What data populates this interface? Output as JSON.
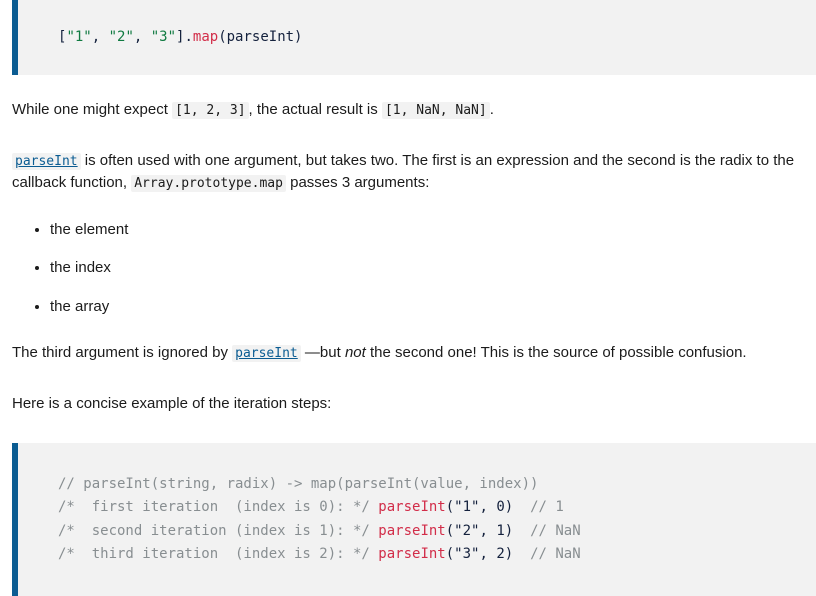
{
  "top_code_block": {
    "name": "map-parseint-example",
    "lines": [
      [
        {
          "t": "[",
          "c": "plain"
        },
        {
          "t": "\"1\"",
          "c": "str"
        },
        {
          "t": ", ",
          "c": "plain"
        },
        {
          "t": "\"2\"",
          "c": "str"
        },
        {
          "t": ", ",
          "c": "plain"
        },
        {
          "t": "\"3\"",
          "c": "str"
        },
        {
          "t": "].",
          "c": "plain"
        },
        {
          "t": "map",
          "c": "fn"
        },
        {
          "t": "(parseInt)",
          "c": "plain"
        }
      ]
    ],
    "plain_text": "[\"1\", \"2\", \"3\"].map(parseInt)"
  },
  "paragraph_1": {
    "before": "While one might expect ",
    "code_expected": "[1, 2, 3]",
    "middle": ", the actual result is ",
    "code_actual": "[1, NaN, NaN]",
    "after": "."
  },
  "paragraph_2": {
    "link_parseint": "parseInt",
    "text_1": " is often used with one argument, but takes two. The first is an expression and the second is the radix to the callback function, ",
    "code_map": "Array.prototype.map",
    "text_2": " passes 3 arguments:"
  },
  "bullet_list": {
    "items": [
      "the element",
      "the index",
      "the array"
    ]
  },
  "paragraph_3": {
    "text_1": "The third argument is ignored by ",
    "link_parseint": "parseInt",
    "text_2": " —but ",
    "emphasis": "not",
    "text_3": " the second one! This is the source of possible confusion."
  },
  "paragraph_4": {
    "text": "Here is a concise example of the iteration steps:"
  },
  "bottom_code_block": {
    "name": "iteration-steps-example",
    "lines": [
      [
        {
          "t": "// parseInt(string, radix) -> map(parseInt(value, index))",
          "c": "comment"
        }
      ],
      [
        {
          "t": "/*  first iteration  (index is 0): */ ",
          "c": "comment"
        },
        {
          "t": "parseInt",
          "c": "fn"
        },
        {
          "t": "(",
          "c": "plain"
        },
        {
          "t": "\"1\"",
          "c": "plain"
        },
        {
          "t": ", ",
          "c": "plain"
        },
        {
          "t": "0",
          "c": "num"
        },
        {
          "t": ")",
          "c": "plain"
        },
        {
          "t": "  ",
          "c": "plain"
        },
        {
          "t": "// 1",
          "c": "comment"
        }
      ],
      [
        {
          "t": "/*  second iteration (index is 1): */ ",
          "c": "comment"
        },
        {
          "t": "parseInt",
          "c": "fn"
        },
        {
          "t": "(",
          "c": "plain"
        },
        {
          "t": "\"2\"",
          "c": "plain"
        },
        {
          "t": ", ",
          "c": "plain"
        },
        {
          "t": "1",
          "c": "num"
        },
        {
          "t": ")",
          "c": "plain"
        },
        {
          "t": "  ",
          "c": "plain"
        },
        {
          "t": "// NaN",
          "c": "comment"
        }
      ],
      [
        {
          "t": "/*  third iteration  (index is 2): */ ",
          "c": "comment"
        },
        {
          "t": "parseInt",
          "c": "fn"
        },
        {
          "t": "(",
          "c": "plain"
        },
        {
          "t": "\"3\"",
          "c": "plain"
        },
        {
          "t": ", ",
          "c": "plain"
        },
        {
          "t": "2",
          "c": "num"
        },
        {
          "t": ")",
          "c": "plain"
        },
        {
          "t": "  ",
          "c": "plain"
        },
        {
          "t": "// NaN",
          "c": "comment"
        }
      ]
    ],
    "plain_text": "// parseInt(string, radix) -> map(parseInt(value, index))\n/*  first iteration  (index is 0): */ parseInt(\"1\", 0)  // 1\n/*  second iteration (index is 1): */ parseInt(\"2\", 1)  // NaN\n/*  third iteration  (index is 2): */ parseInt(\"3\", 2)  // NaN"
  },
  "colors": {
    "page_background": "#ffffff",
    "code_background": "#f2f2f2",
    "code_accent_border": "#0b5c92",
    "link": "#0b5c92",
    "token_string": "#107a41",
    "token_function": "#d22d49",
    "token_comment": "#888e91",
    "body_text": "#1b1b1b"
  }
}
